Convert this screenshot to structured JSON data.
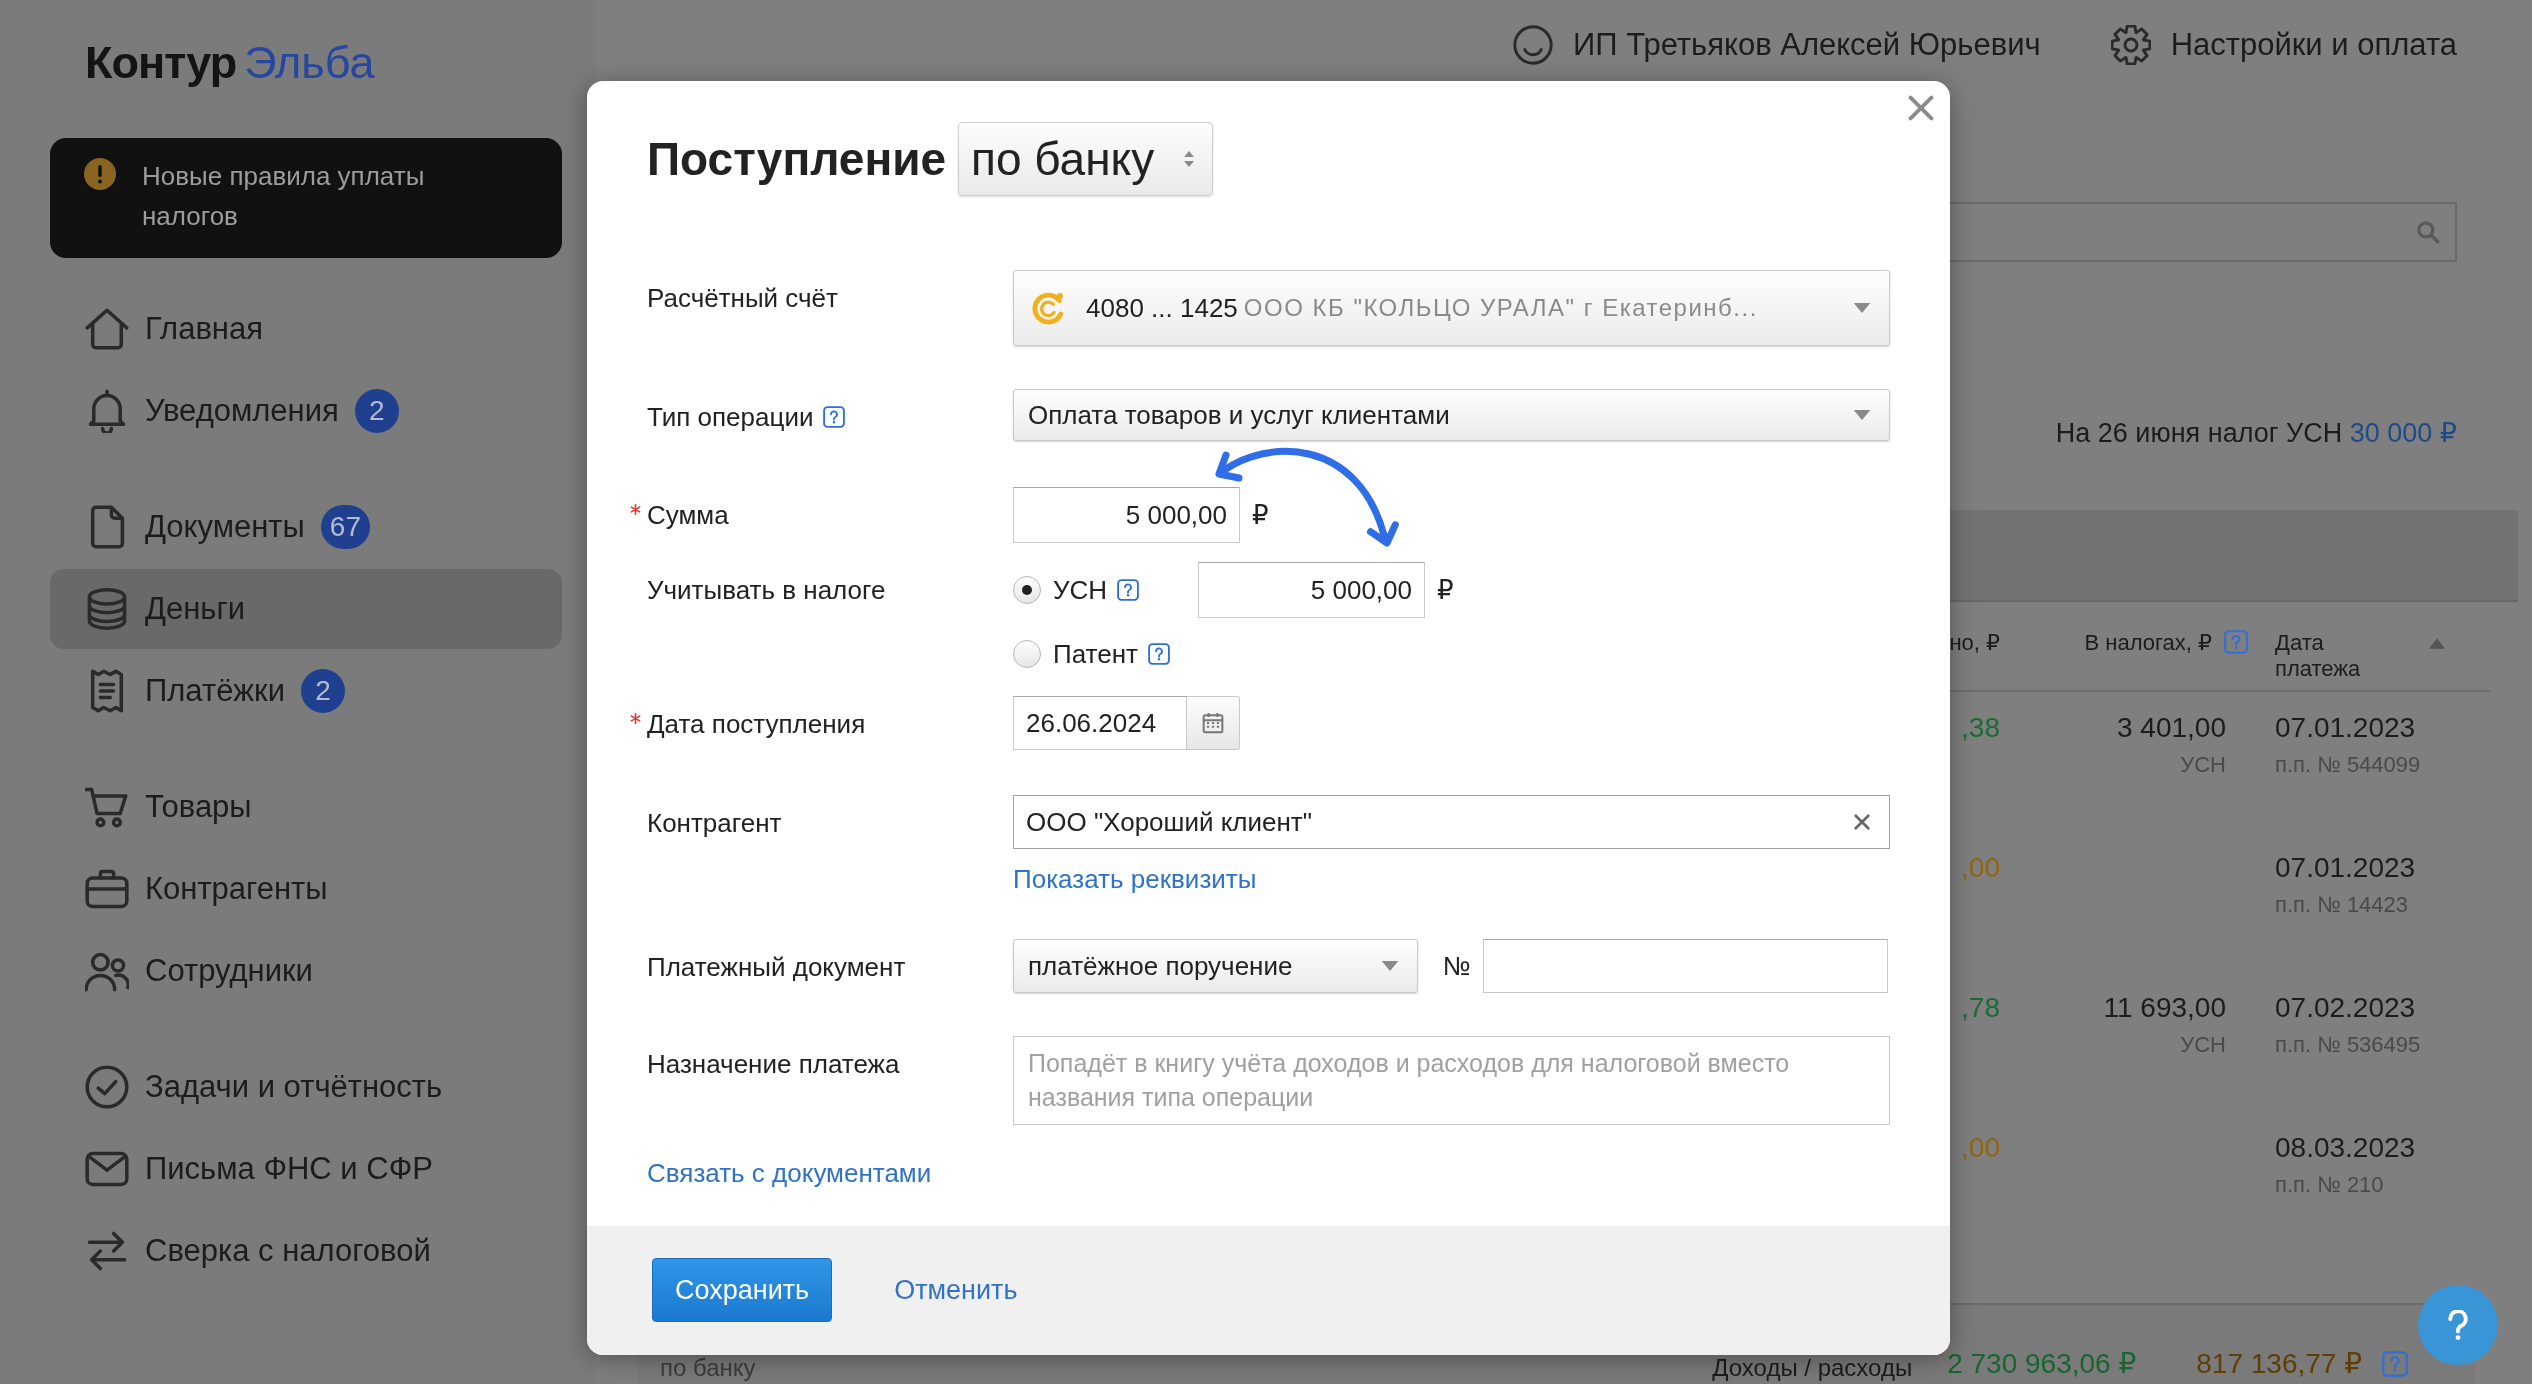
{
  "header": {
    "user": "ИП Третьяков Алексей Юрьевич",
    "settings": "Настройки и оплата"
  },
  "sidebar": {
    "logo": {
      "brand": "Контур",
      "product": "Эльба"
    },
    "notice": "Новые правила уплаты налогов",
    "groups": [
      {
        "items": [
          {
            "label": "Главная",
            "selected": false
          },
          {
            "label": "Уведомления",
            "badge": "2",
            "selected": false
          }
        ]
      },
      {
        "items": [
          {
            "label": "Документы",
            "badge": "67",
            "selected": false
          },
          {
            "label": "Деньги",
            "selected": true
          },
          {
            "label": "Платёжки",
            "badge": "2",
            "selected": false
          }
        ]
      },
      {
        "items": [
          {
            "label": "Товары",
            "selected": false
          },
          {
            "label": "Контрагенты",
            "selected": false
          },
          {
            "label": "Сотрудники",
            "selected": false
          }
        ]
      },
      {
        "items": [
          {
            "label": "Задачи и отчётность",
            "selected": false
          },
          {
            "label": "Письма ФНС и СФР",
            "selected": false
          },
          {
            "label": "Сверка с налоговой",
            "selected": false
          }
        ]
      }
    ]
  },
  "tax_summary": {
    "text": "На 26 июня налог УСН",
    "amount": "30 000 ₽"
  },
  "table": {
    "columns": [
      {
        "label": "но, ₽"
      },
      {
        "label": "В налогах, ₽",
        "help": true
      },
      {
        "label": "Дата платежа",
        "sorted": true
      }
    ],
    "rows": [
      {
        "amount": ",38",
        "color": "#1d6a35",
        "tax": "3 401,00",
        "tax_regime": "УСН",
        "date": "07.01.2023",
        "document": "п.п. № 544099"
      },
      {
        "amount": ",00",
        "color": "#8f6415",
        "date": "07.01.2023",
        "document": "п.п. № 14423"
      },
      {
        "amount": ",78",
        "color": "#1d6a35",
        "tax": "11 693,00",
        "tax_regime": "УСН",
        "date": "07.02.2023",
        "document": "п.п. № 536495"
      },
      {
        "amount": ",00",
        "color": "#8f6415",
        "date": "08.03.2023",
        "document": "п.п. № 210"
      }
    ],
    "footer": {
      "label": "по банку",
      "totals_label": "Доходы / расходы",
      "income": "2 730 963,06 ₽",
      "expense": "817 136,77 ₽",
      "help": true
    }
  },
  "dialog": {
    "title": "Поступление",
    "mode": "по банку",
    "fields": [
      {
        "kind": "account",
        "label": "Расчётный счёт",
        "required": false,
        "help": false,
        "number": "4080 ... 1425",
        "bank": "ООО КБ \"КОЛЬЦО УРАЛА\" г Екатеринб..."
      },
      {
        "kind": "select",
        "label": "Тип операции",
        "required": false,
        "help": true,
        "value": "Оплата товаров и услуг клиентами"
      },
      {
        "kind": "amount",
        "label": "Сумма",
        "required": true,
        "help": false,
        "value": "5 000,00",
        "currency": "₽"
      },
      {
        "kind": "tax",
        "label": "Учитывать в налоге",
        "required": false,
        "help": false,
        "options": [
          {
            "label": "УСН",
            "help": true,
            "selected": true,
            "value": "5 000,00",
            "currency": "₽"
          },
          {
            "label": "Патент",
            "help": true,
            "selected": false
          }
        ]
      },
      {
        "kind": "date",
        "label": "Дата поступления",
        "required": true,
        "help": false,
        "value": "26.06.2024"
      },
      {
        "kind": "counterparty",
        "label": "Контрагент",
        "required": false,
        "help": false,
        "value": "ООО \"Хороший клиент\"",
        "link": "Показать реквизиты"
      },
      {
        "kind": "document",
        "label": "Платежный документ",
        "required": false,
        "help": false,
        "value": "платёжное поручение",
        "number_label": "№"
      },
      {
        "kind": "textarea",
        "label": "Назначение платежа",
        "required": false,
        "help": false,
        "placeholder": "Попадёт в книгу учёта доходов и расходов для налоговой вместо названия типа операции"
      }
    ],
    "link": "Связать с документами",
    "buttons": [
      {
        "label": "Сохранить",
        "kind": "primary"
      },
      {
        "label": "Отменить",
        "kind": "link"
      }
    ]
  }
}
